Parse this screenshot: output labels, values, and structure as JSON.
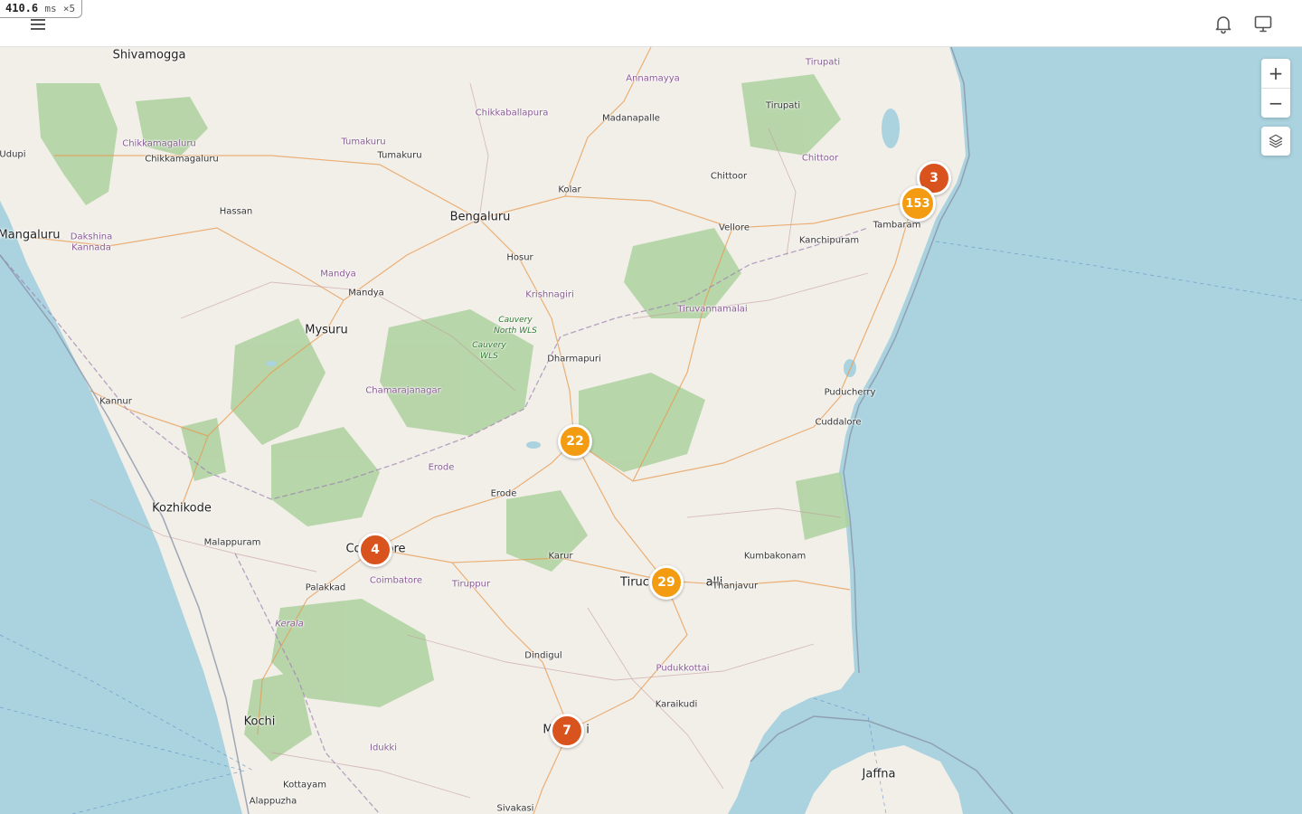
{
  "perf": {
    "value": "410.6",
    "unit": "ms",
    "multiplier": "×5"
  },
  "header": {
    "menu_icon": "hamburger-menu-icon",
    "notifications_icon": "bell-icon",
    "display_icon": "monitor-icon"
  },
  "map_controls": {
    "zoom_in": "+",
    "zoom_out": "−",
    "layers_icon": "layers-icon"
  },
  "colors": {
    "water": "#aad3df",
    "land": "#f2efe9",
    "forest": "#add19e",
    "cluster_orange": "#f39c12",
    "cluster_red": "#d9531e"
  },
  "clusters": [
    {
      "count": "3",
      "color": "red"
    },
    {
      "count": "153",
      "color": "orange"
    },
    {
      "count": "22",
      "color": "orange"
    },
    {
      "count": "4",
      "color": "red"
    },
    {
      "count": "29",
      "color": "orange"
    },
    {
      "count": "7",
      "color": "red"
    }
  ],
  "labels": [
    {
      "text": "Shivamogga",
      "kind": "city"
    },
    {
      "text": "Tirupati",
      "kind": "district"
    },
    {
      "text": "Annamayya",
      "kind": "district"
    },
    {
      "text": "Chikkaballapura",
      "kind": "district"
    },
    {
      "text": "Madanapalle",
      "kind": "town"
    },
    {
      "text": "Tirupati",
      "kind": "town"
    },
    {
      "text": "Chikkamagaluru",
      "kind": "district"
    },
    {
      "text": "Chikkamagaluru",
      "kind": "town"
    },
    {
      "text": "Tumakuru",
      "kind": "district"
    },
    {
      "text": "Tumakuru",
      "kind": "town"
    },
    {
      "text": "Udupi",
      "kind": "town"
    },
    {
      "text": "Chittoor",
      "kind": "town"
    },
    {
      "text": "Chittoor",
      "kind": "district"
    },
    {
      "text": "Kolar",
      "kind": "town"
    },
    {
      "text": "Hassan",
      "kind": "town"
    },
    {
      "text": "Bengaluru",
      "kind": "city"
    },
    {
      "text": "Tambaram",
      "kind": "town"
    },
    {
      "text": "Vellore",
      "kind": "town"
    },
    {
      "text": "Kanchipuram",
      "kind": "town"
    },
    {
      "text": "Mangaluru",
      "kind": "city"
    },
    {
      "text": "Dakshina",
      "kind": "district"
    },
    {
      "text": "Kannada",
      "kind": "district"
    },
    {
      "text": "Hosur",
      "kind": "town"
    },
    {
      "text": "Mandya",
      "kind": "district"
    },
    {
      "text": "Mandya",
      "kind": "town"
    },
    {
      "text": "Krishnagiri",
      "kind": "district"
    },
    {
      "text": "Tiruvannamalai",
      "kind": "district"
    },
    {
      "text": "Mysuru",
      "kind": "city"
    },
    {
      "text": "Cauvery",
      "kind": "park"
    },
    {
      "text": "North WLS",
      "kind": "park"
    },
    {
      "text": "Cauvery",
      "kind": "park"
    },
    {
      "text": "WLS",
      "kind": "park"
    },
    {
      "text": "Dharmapuri",
      "kind": "town"
    },
    {
      "text": "Chamarajanagar",
      "kind": "district"
    },
    {
      "text": "Puducherry",
      "kind": "town"
    },
    {
      "text": "Kannur",
      "kind": "town"
    },
    {
      "text": "Cuddalore",
      "kind": "town"
    },
    {
      "text": "Erode",
      "kind": "district"
    },
    {
      "text": "Erode",
      "kind": "town"
    },
    {
      "text": "Kozhikode",
      "kind": "city"
    },
    {
      "text": "Malappuram",
      "kind": "town"
    },
    {
      "text": "Co",
      "kind": "city"
    },
    {
      "text": "ore",
      "kind": "city"
    },
    {
      "text": "Karur",
      "kind": "town"
    },
    {
      "text": "Kumbakonam",
      "kind": "town"
    },
    {
      "text": "Coimbatore",
      "kind": "district"
    },
    {
      "text": "Tiruppur",
      "kind": "district"
    },
    {
      "text": "Palakkad",
      "kind": "town"
    },
    {
      "text": "Tiruc",
      "kind": "city"
    },
    {
      "text": "alli",
      "kind": "city"
    },
    {
      "text": "Thanjavur",
      "kind": "town"
    },
    {
      "text": "Kerala",
      "kind": "region"
    },
    {
      "text": "Dindigul",
      "kind": "town"
    },
    {
      "text": "Pudukkottai",
      "kind": "district"
    },
    {
      "text": "Karaikudi",
      "kind": "town"
    },
    {
      "text": "Kochi",
      "kind": "city"
    },
    {
      "text": "M",
      "kind": "city"
    },
    {
      "text": "i",
      "kind": "city"
    },
    {
      "text": "Idukki",
      "kind": "district"
    },
    {
      "text": "Jaffna",
      "kind": "city"
    },
    {
      "text": "Kottayam",
      "kind": "town"
    },
    {
      "text": "Alappuzha",
      "kind": "town"
    },
    {
      "text": "Sivakasi",
      "kind": "town"
    }
  ]
}
